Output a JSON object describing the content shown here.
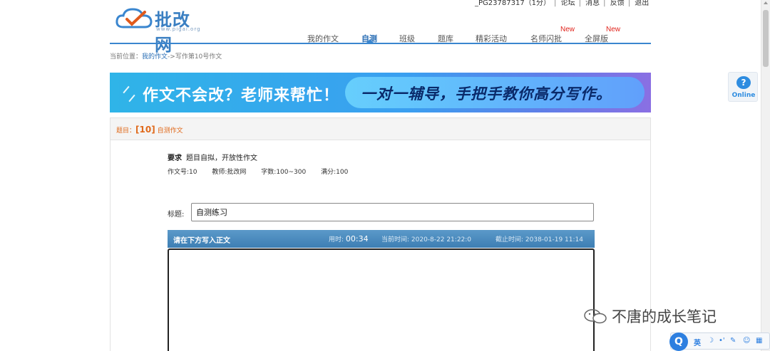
{
  "header": {
    "logo_text": "批改网",
    "logo_sub": "www.pigai.org",
    "user_info": "_PG23787317（1分）",
    "user_links": [
      "论坛",
      "消息",
      "反馈",
      "退出"
    ]
  },
  "nav": {
    "items": [
      {
        "label": "我的作文",
        "active": false,
        "new": false
      },
      {
        "label": "自测",
        "active": true,
        "new": false
      },
      {
        "label": "班级",
        "active": false,
        "new": false
      },
      {
        "label": "题库",
        "active": false,
        "new": false
      },
      {
        "label": "精彩活动",
        "active": false,
        "new": false
      },
      {
        "label": "名师闪批",
        "active": false,
        "new": true
      },
      {
        "label": "全屏版",
        "active": false,
        "new": true
      }
    ],
    "new_badge": "New"
  },
  "breadcrumb": {
    "prefix": "当前位置：",
    "link": "我的作文",
    "rest": "->写作第10号作文"
  },
  "banner": {
    "left_text": "作文不会改？老师来帮忙！",
    "right_text": "一对一辅导，手把手教你高分写作。"
  },
  "topic": {
    "prefix": "题目：",
    "number": "[10]",
    "name": "自测作文"
  },
  "requirement": {
    "label": "要求",
    "text": "题目自拟，开放性作文"
  },
  "meta": {
    "essay_no": "作文号:10",
    "teacher": "教师:批改网",
    "word_count": "字数:100~300",
    "full_score": "满分:100"
  },
  "title_field": {
    "label": "标题:",
    "value": "自测练习"
  },
  "editor": {
    "instruction": "请在下方写入正文",
    "time_used_label": "用时:",
    "time_used": "00:34",
    "current_time": "当前时间: 2020-8-22 21:22:0",
    "deadline": "截止时间: 2038-01-19 11:14"
  },
  "online_widget": {
    "label": "Online",
    "icon": "question-bubble-icon"
  },
  "watermark": {
    "text": "不唐的成长笔记",
    "icon": "wechat-icon"
  },
  "ime_bar": {
    "logo": "Q",
    "lang": "英",
    "icons": [
      "moon-icon",
      "punctuation-icon",
      "wrench-icon",
      "emoji-icon",
      "grid-icon"
    ]
  }
}
